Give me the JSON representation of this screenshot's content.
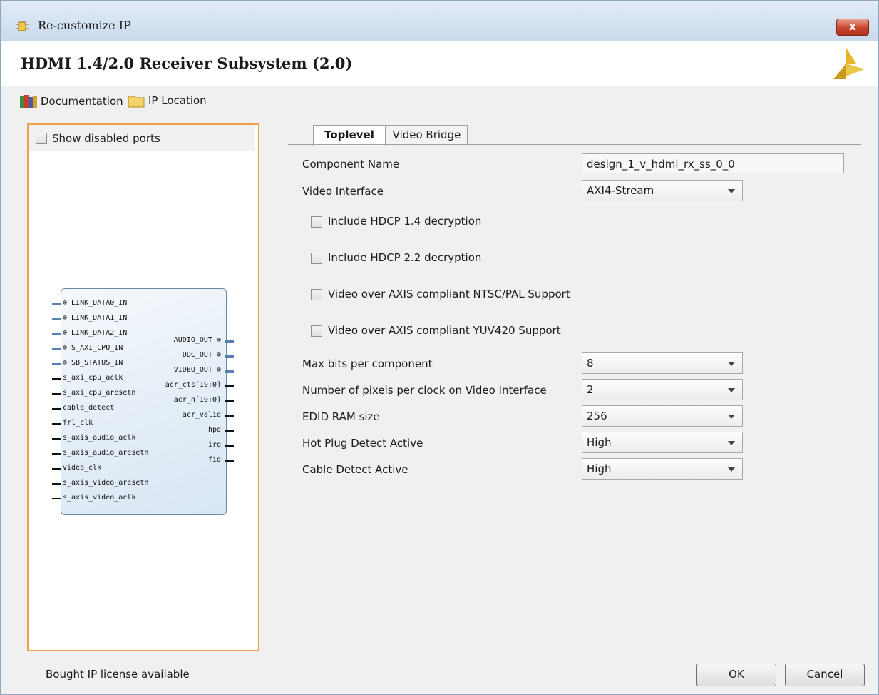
{
  "window": {
    "title": "Re-customize IP",
    "close_label": "x"
  },
  "header": {
    "title": "HDMI 1.4/2.0 Receiver Subsystem (2.0)"
  },
  "toolbar": {
    "documentation_label": "Documentation",
    "ip_location_label": "IP Location"
  },
  "left_panel": {
    "show_disabled_ports_label": "Show disabled ports",
    "block": {
      "left_pins": [
        "LINK_DATA0_IN",
        "LINK_DATA1_IN",
        "LINK_DATA2_IN",
        "S_AXI_CPU_IN",
        "SB_STATUS_IN",
        "s_axi_cpu_aclk",
        "s_axi_cpu_aresetn",
        "cable_detect",
        "frl_clk",
        "s_axis_audio_aclk",
        "s_axis_audio_aresetn",
        "video_clk",
        "s_axis_video_aresetn",
        "s_axis_video_aclk"
      ],
      "right_pins": [
        "AUDIO_OUT",
        "DDC_OUT",
        "VIDEO_OUT",
        "acr_cts[19:0]",
        "acr_n[19:0]",
        "acr_valid",
        "hpd",
        "irq",
        "fid"
      ]
    }
  },
  "tabs": [
    "Toplevel",
    "Video Bridge"
  ],
  "active_tab": "Toplevel",
  "form": {
    "component_name_label": "Component Name",
    "component_name_value": "design_1_v_hdmi_rx_ss_0_0",
    "video_interface_label": "Video Interface",
    "video_interface_value": "AXI4-Stream",
    "checkboxes": [
      "Include HDCP 1.4 decryption",
      "Include HDCP 2.2 decryption",
      "Video over AXIS compliant NTSC/PAL Support",
      "Video over AXIS compliant YUV420 Support"
    ],
    "selects": [
      {
        "label": "Max bits per component",
        "value": "8"
      },
      {
        "label": "Number of pixels per clock on Video Interface",
        "value": "2"
      },
      {
        "label": "EDID RAM size",
        "value": "256"
      },
      {
        "label": "Hot Plug Detect Active",
        "value": "High"
      },
      {
        "label": "Cable Detect Active",
        "value": "High"
      }
    ]
  },
  "footer": {
    "license_text": "Bought IP license available",
    "ok_label": "OK",
    "cancel_label": "Cancel"
  },
  "colors": {
    "panel_border": "#f0a04a",
    "close_button": "#c8432c",
    "block_fill": "#d8e6f3"
  }
}
